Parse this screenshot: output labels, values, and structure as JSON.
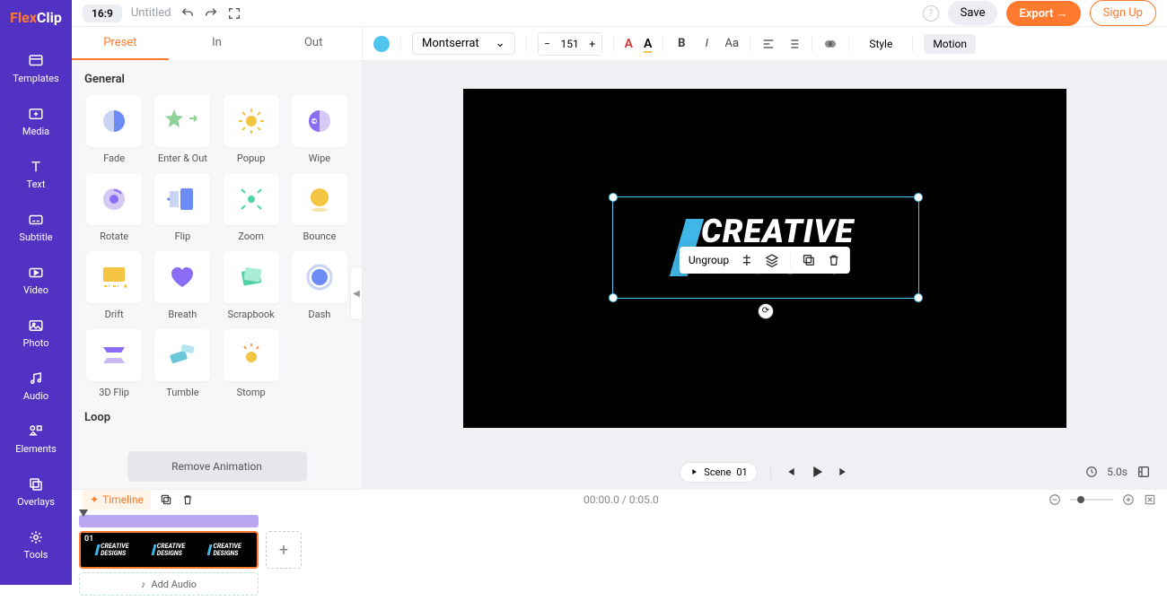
{
  "app": {
    "logo_left": "Flex",
    "logo_right": "Clip"
  },
  "header": {
    "ratio": "16:9",
    "title": "Untitled",
    "save": "Save",
    "export": "Export",
    "signup": "Sign Up"
  },
  "sidebar": {
    "items": [
      {
        "label": "Templates"
      },
      {
        "label": "Media"
      },
      {
        "label": "Text"
      },
      {
        "label": "Subtitle"
      },
      {
        "label": "Video"
      },
      {
        "label": "Photo"
      },
      {
        "label": "Audio"
      },
      {
        "label": "Elements"
      },
      {
        "label": "Overlays"
      },
      {
        "label": "Tools"
      }
    ]
  },
  "motion_panel": {
    "tabs": {
      "preset": "Preset",
      "in": "In",
      "out": "Out"
    },
    "section": "General",
    "section2": "Loop",
    "presets": [
      {
        "label": "Fade"
      },
      {
        "label": "Enter & Out"
      },
      {
        "label": "Popup"
      },
      {
        "label": "Wipe"
      },
      {
        "label": "Rotate"
      },
      {
        "label": "Flip"
      },
      {
        "label": "Zoom"
      },
      {
        "label": "Bounce"
      },
      {
        "label": "Drift"
      },
      {
        "label": "Breath"
      },
      {
        "label": "Scrapbook"
      },
      {
        "label": "Dash"
      },
      {
        "label": "3D Flip"
      },
      {
        "label": "Tumble"
      },
      {
        "label": "Stomp"
      }
    ],
    "remove": "Remove Animation"
  },
  "toolbar": {
    "font": "Montserrat",
    "size": "151",
    "style": "Style",
    "motion": "Motion"
  },
  "context": {
    "ungroup": "Ungroup"
  },
  "canvas": {
    "line1": "CREATIVE",
    "line2": "DESIGNS"
  },
  "playback": {
    "scene_label": "Scene",
    "scene_num": "01",
    "duration": "5.0s"
  },
  "timeline": {
    "toggle": "Timeline",
    "timecode": "00:00.0 / 0:05.0",
    "clip_num": "01",
    "clip_text1": "CREATIVE",
    "clip_text2": "DESIGNS",
    "add_audio": "Add Audio"
  }
}
